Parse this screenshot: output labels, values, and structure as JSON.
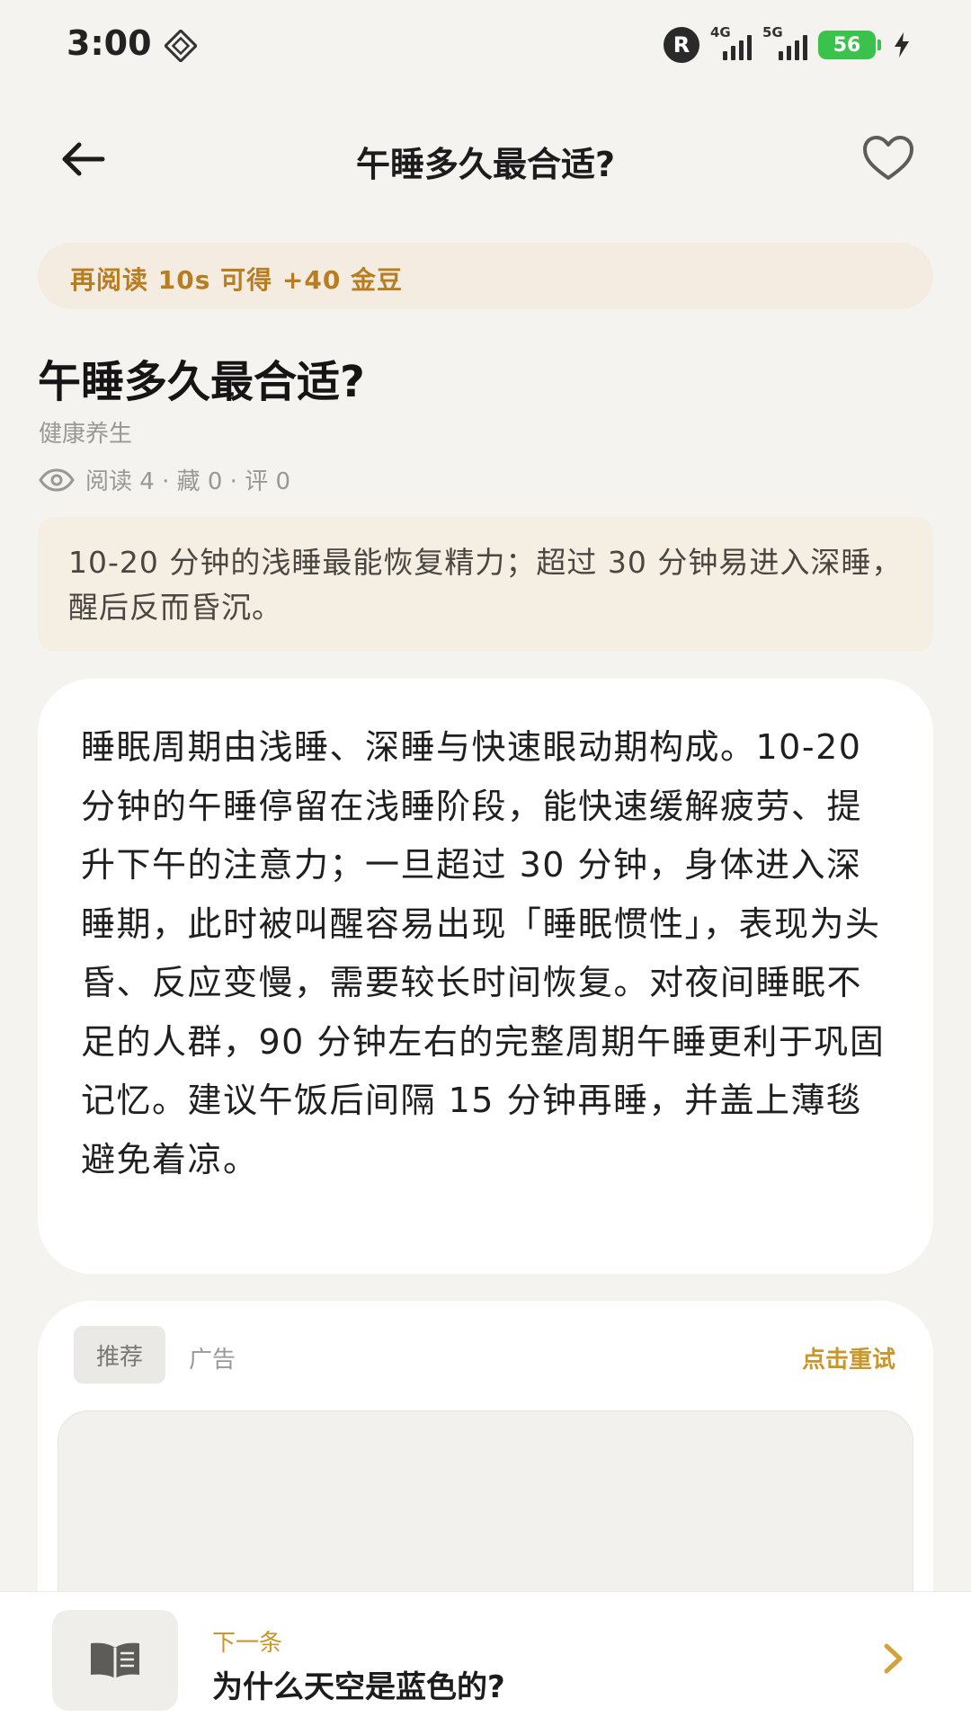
{
  "status_bar": {
    "time": "3:00",
    "r_badge": "R",
    "signal1_label": "4G",
    "signal2_label": "5G",
    "battery": "56"
  },
  "header": {
    "title": "午睡多久最合适?",
    "back_icon": "arrow-left-icon",
    "favorite_icon": "heart-icon"
  },
  "reward": {
    "text": "再阅读 10s 可得 +40 金豆"
  },
  "article": {
    "title": "午睡多久最合适?",
    "category": "健康养生",
    "meta": "阅读 4 · 藏 0 · 评 0",
    "summary": "10-20 分钟的浅睡最能恢复精力；超过 30 分钟易进入深睡，醒后反而昏沉。",
    "body": "睡眠周期由浅睡、深睡与快速眼动期构成。10-20 分钟的午睡停留在浅睡阶段，能快速缓解疲劳、提升下午的注意力；一旦超过 30 分钟，身体进入深睡期，此时被叫醒容易出现「睡眠惯性」，表现为头昏、反应变慢，需要较长时间恢复。对夜间睡眠不足的人群，90 分钟左右的完整周期午睡更利于巩固记忆。建议午饭后间隔 15 分钟再睡，并盖上薄毯避免着凉。"
  },
  "recommend": {
    "tab_recommend": "推荐",
    "tab_ad": "广告",
    "retry": "点击重试"
  },
  "next": {
    "label": "下一条",
    "title": "为什么天空是蓝色的?"
  },
  "colors": {
    "accent": "#c9962c",
    "reward_text": "#b77d20",
    "battery": "#3bc24d"
  }
}
